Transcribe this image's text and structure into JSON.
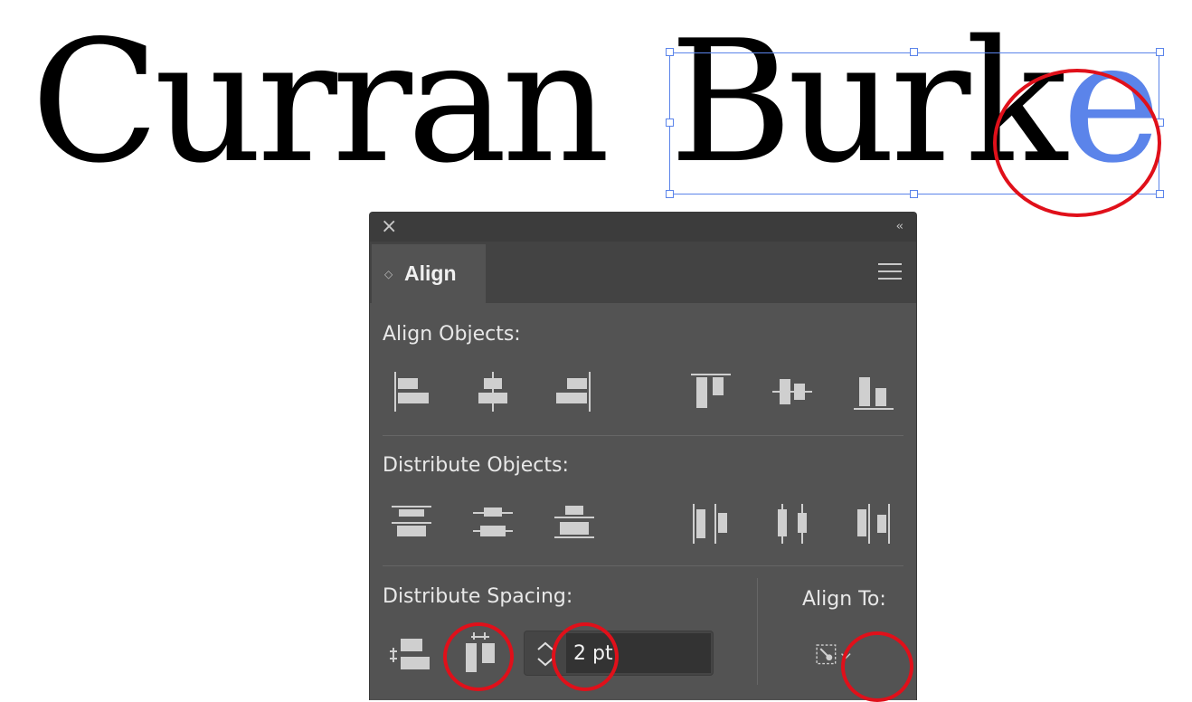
{
  "artboard": {
    "first_word": "Curran",
    "second_word_prefix": "Burk",
    "second_word_selected_letter": "e"
  },
  "colors": {
    "selection": "#5b84ea",
    "annotation_circle": "#e0101a",
    "panel_bg": "#535353"
  },
  "panel": {
    "close_icon": "×",
    "collapse_icon": "‹‹",
    "tab_icon": "◇",
    "tab_title": "Align",
    "menu_icon": "hamburger-menu-icon",
    "align_objects_label": "Align Objects:",
    "distribute_objects_label": "Distribute Objects:",
    "distribute_spacing_label": "Distribute Spacing:",
    "align_to_label": "Align To:",
    "spacing_value": "2 pt"
  }
}
